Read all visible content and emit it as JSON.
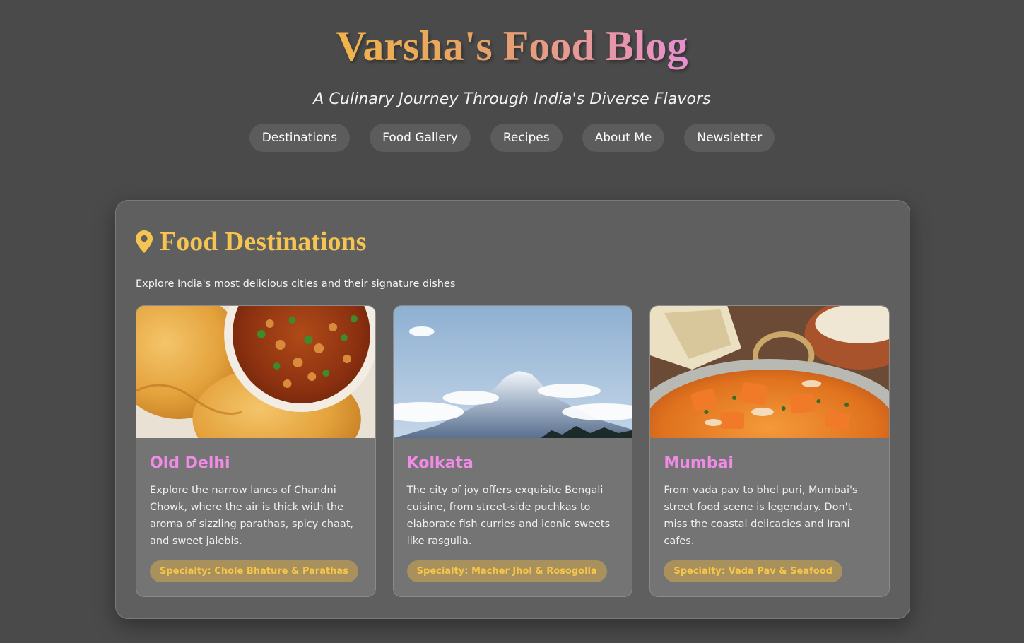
{
  "header": {
    "title": "Varsha's Food Blog",
    "tagline": "A Culinary Journey Through India's Diverse Flavors"
  },
  "nav": {
    "items": [
      {
        "label": "Destinations"
      },
      {
        "label": "Food Gallery"
      },
      {
        "label": "Recipes"
      },
      {
        "label": "About Me"
      },
      {
        "label": "Newsletter"
      }
    ]
  },
  "destinations": {
    "icon": "map-pin-icon",
    "title": "Food Destinations",
    "subtitle": "Explore India's most delicious cities and their signature dishes",
    "cards": [
      {
        "name": "Old Delhi",
        "description": "Explore the narrow lanes of Chandni Chowk, where the air is thick with the aroma of sizzling parathas, spicy chaat, and sweet jalebis.",
        "specialty": "Specialty: Chole Bhature & Parathas"
      },
      {
        "name": "Kolkata",
        "description": "The city of joy offers exquisite Bengali cuisine, from street-side puchkas to elaborate fish curries and iconic sweets like rasgulla.",
        "specialty": "Specialty: Macher Jhol & Rosogolla"
      },
      {
        "name": "Mumbai",
        "description": "From vada pav to bhel puri, Mumbai's street food scene is legendary. Don't miss the coastal delicacies and Irani cafes.",
        "specialty": "Specialty: Vada Pav & Seafood"
      }
    ]
  },
  "colors": {
    "background": "#4a4a4a",
    "accent_gold": "#f5c451",
    "accent_pink": "#f08ce8"
  }
}
